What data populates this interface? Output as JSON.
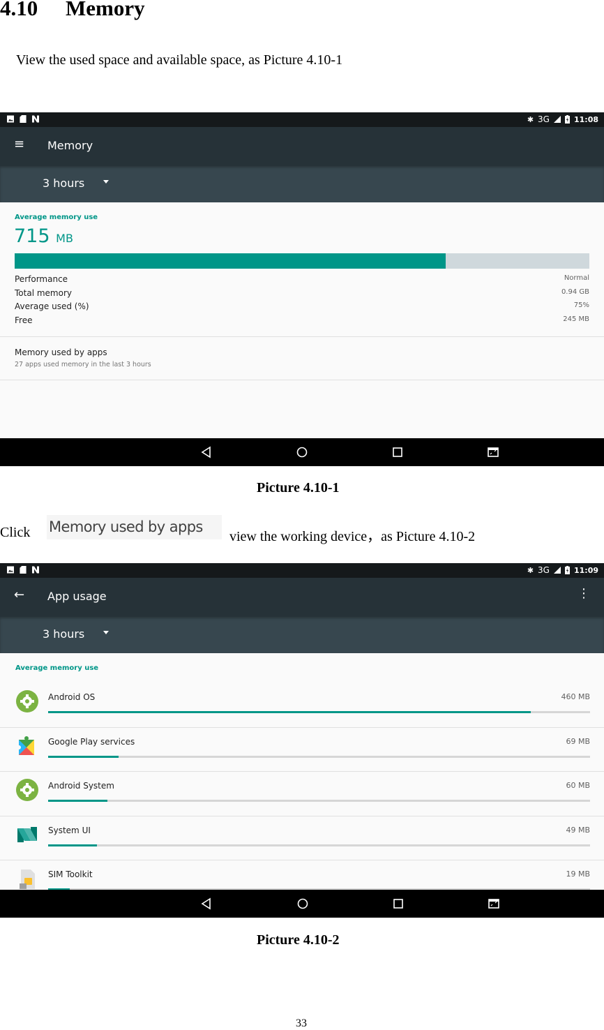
{
  "section": {
    "number": "4.10",
    "title": "Memory"
  },
  "intro": "View the used space and available space, as Picture 4.10-1",
  "caption1": "Picture 4.10-1",
  "click_text": {
    "prefix": "Click",
    "button_label": "Memory used by apps",
    "suffix": "view the working device，as Picture 4.10-2"
  },
  "caption2": "Picture 4.10-2",
  "page_number": "33",
  "colors": {
    "accent": "#009688",
    "toolbar": "#263238",
    "spinner": "#37474f",
    "statusbar": "#15191b",
    "bar_track": "#cfd8dc"
  },
  "screen1": {
    "status": {
      "network": "3G",
      "time": "11:08",
      "icons_left": [
        "gallery-icon",
        "sd-card-icon",
        "n-icon"
      ]
    },
    "toolbar": {
      "title": "Memory",
      "nav_icon": "menu-icon"
    },
    "spinner": {
      "selected": "3 hours"
    },
    "summary": {
      "label": "Average memory use",
      "value": "715",
      "unit": "MB",
      "used_fraction": 0.75
    },
    "stats": [
      {
        "label": "Performance",
        "value": "Normal"
      },
      {
        "label": "Total memory",
        "value": "0.94 GB"
      },
      {
        "label": "Average used (%)",
        "value": "75%"
      },
      {
        "label": "Free",
        "value": "245 MB"
      }
    ],
    "apps_item": {
      "title": "Memory used by apps",
      "subtitle": "27 apps used memory in the last 3 hours"
    }
  },
  "screen2": {
    "status": {
      "network": "3G",
      "time": "11:09",
      "icons_left": [
        "gallery-icon",
        "sd-card-icon",
        "n-icon"
      ]
    },
    "toolbar": {
      "title": "App usage",
      "nav_icon": "back-arrow-icon",
      "menu_icon": "more-vert-icon"
    },
    "spinner": {
      "selected": "3 hours"
    },
    "list_label": "Average memory use",
    "apps": [
      {
        "name": "Android OS",
        "value": "460 MB",
        "fraction": 0.89,
        "icon": "settings-gear-icon"
      },
      {
        "name": "Google Play services",
        "value": "69 MB",
        "fraction": 0.13,
        "icon": "play-services-icon"
      },
      {
        "name": "Android System",
        "value": "60 MB",
        "fraction": 0.11,
        "icon": "settings-gear-icon"
      },
      {
        "name": "System UI",
        "value": "49 MB",
        "fraction": 0.09,
        "icon": "system-ui-icon"
      },
      {
        "name": "SIM Toolkit",
        "value": "19 MB",
        "fraction": 0.04,
        "icon": "sim-toolkit-icon"
      }
    ]
  }
}
